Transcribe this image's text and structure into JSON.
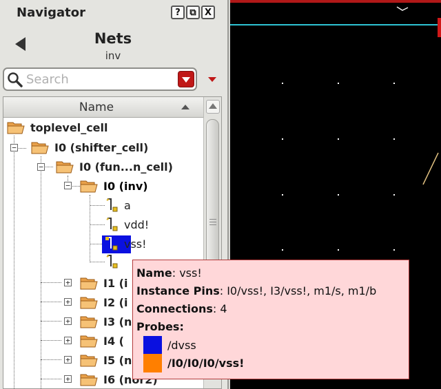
{
  "navigator": {
    "title": "Navigator",
    "buttons": {
      "help": "?",
      "float": "⧉",
      "close": "X"
    },
    "view_title": "Nets",
    "view_subtitle": "inv",
    "search": {
      "placeholder": "Search",
      "value": ""
    },
    "column_header": "Name",
    "tree": [
      {
        "label": "toplevel_cell"
      },
      {
        "label": "I0 (shifter_cell)"
      },
      {
        "label": "I0 (fun...n_cell)"
      },
      {
        "label": "I0 (inv)"
      },
      {
        "label": "a"
      },
      {
        "label": "vdd!"
      },
      {
        "label": "vss!"
      },
      {
        "label": "I1 (i"
      },
      {
        "label": "I2 (i"
      },
      {
        "label": "I3 (n"
      },
      {
        "label": "I4 ("
      },
      {
        "label": "I5 (n"
      },
      {
        "label": "I6 (nor2)"
      }
    ]
  },
  "tooltip": {
    "name_label": "Name",
    "name_value": ": vss!",
    "pins_label": "Instance Pins",
    "pins_value": ": I0/vss!, I3/vss!, m1/s, m1/b",
    "connections_label": "Connections",
    "connections_value": ": 4",
    "probes_label": "Probes:",
    "probes": [
      {
        "label": "/dvss",
        "color": "#0a10e0"
      },
      {
        "label": "/I0/I0/I0/vss!",
        "color": "#ff7f00"
      }
    ]
  },
  "colors": {
    "selection": "#0a10e0",
    "accent_red": "#c01818",
    "canvas_bg": "#000000",
    "cyan_line": "#2ec4d4",
    "tooltip_bg": "#ffd7d9"
  }
}
